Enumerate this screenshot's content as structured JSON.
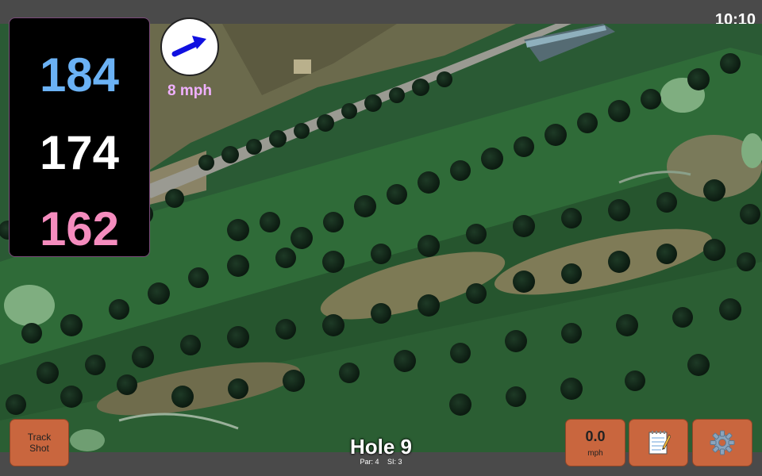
{
  "status": {
    "time": "10:10"
  },
  "distances": {
    "back": "184",
    "middle": "174",
    "front": "162"
  },
  "wind": {
    "speed": "8 mph",
    "direction_icon": "arrow-east-northeast-icon"
  },
  "controls": {
    "track_shot_line1": "Track",
    "track_shot_line2": "Shot",
    "speed_value": "0.0",
    "speed_unit": "mph",
    "notes_icon": "notepad-icon",
    "settings_icon": "gear-icon"
  },
  "hole": {
    "title": "Hole 9",
    "par": "Par: 4",
    "si": "SI: 3"
  },
  "colors": {
    "back_distance": "#6bb2f5",
    "middle_distance": "#ffffff",
    "front_distance": "#f58cbe",
    "button": "#c9663e",
    "wind_text": "#f0b0ff"
  }
}
